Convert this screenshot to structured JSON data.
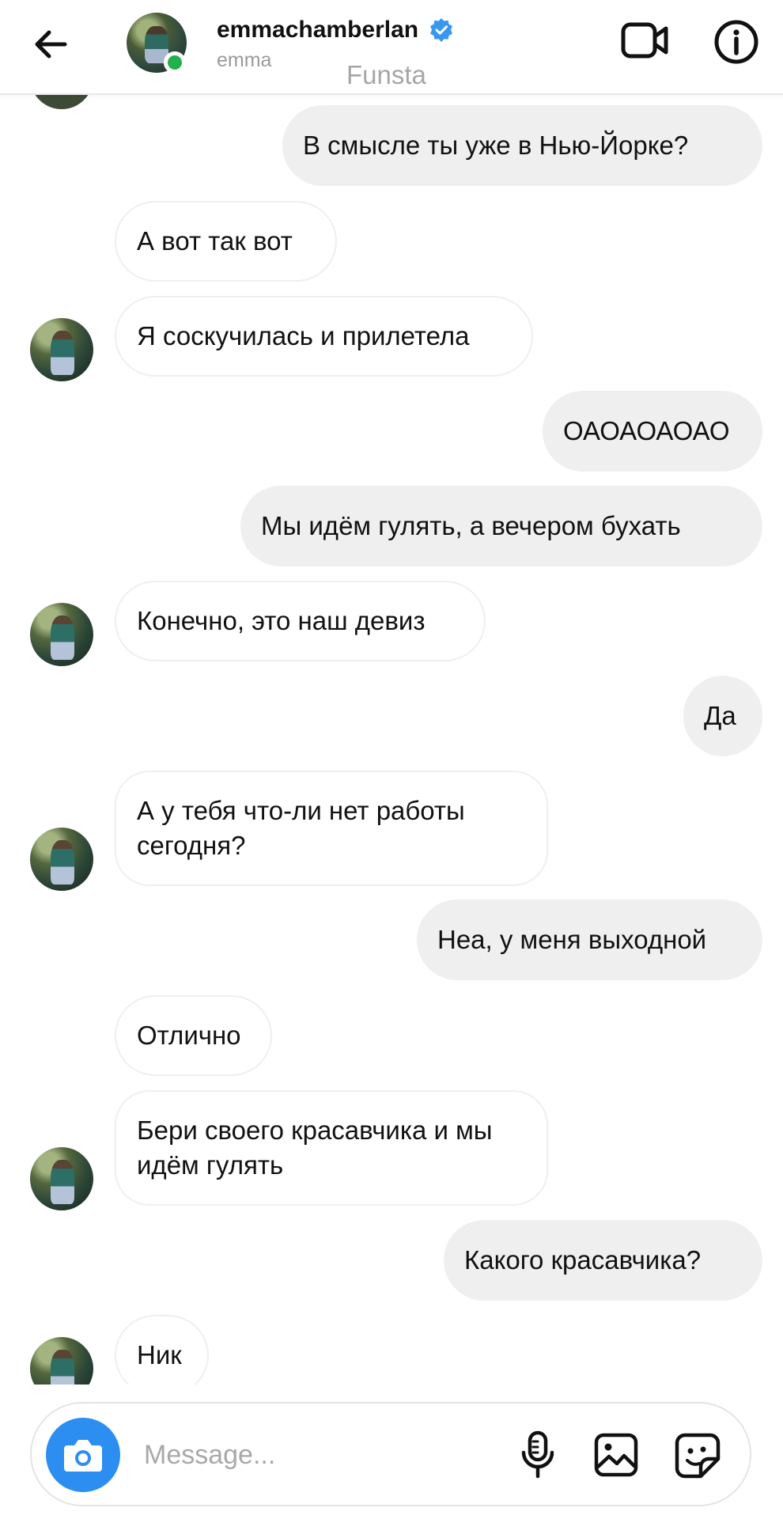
{
  "header": {
    "username": "emmachamberlan",
    "subname": "emma",
    "note": "Funsta",
    "icons": {
      "back": "back-arrow-icon",
      "verified": "verified-badge-icon",
      "video": "video-call-icon",
      "info": "info-icon"
    },
    "status_color": "#22b24c",
    "verified_color": "#3897f0"
  },
  "messages": [
    {
      "direction": "out",
      "text": "В смысле ты уже в Нью-Йорке?"
    },
    {
      "direction": "in",
      "text": "А вот так вот"
    },
    {
      "direction": "in",
      "text": "Я соскучилась и прилетела",
      "avatar": true
    },
    {
      "direction": "out",
      "text": "ОАОАОАОАО"
    },
    {
      "direction": "out",
      "text": "Мы идём гулять, а вечером бухать"
    },
    {
      "direction": "in",
      "text": "Конечно, это наш девиз",
      "avatar": true
    },
    {
      "direction": "out",
      "text": "Да"
    },
    {
      "direction": "in",
      "text": "А у тебя что-ли нет работы сегодня?",
      "avatar": true
    },
    {
      "direction": "out",
      "text": "Неа, у меня выходной"
    },
    {
      "direction": "in",
      "text": "Отлично"
    },
    {
      "direction": "in",
      "text": "Бери своего красавчика и мы идём гулять",
      "avatar": true
    },
    {
      "direction": "out",
      "text": "Какого красавчика?"
    },
    {
      "direction": "in",
      "text": "Ник",
      "avatar": true
    }
  ],
  "composer": {
    "placeholder": "Message...",
    "camera_color": "#2c8ef0",
    "icons": {
      "camera": "camera-icon",
      "mic": "microphone-icon",
      "gallery": "gallery-icon",
      "sticker": "sticker-icon"
    }
  }
}
